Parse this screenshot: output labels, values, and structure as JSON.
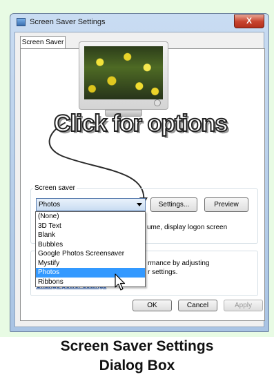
{
  "window": {
    "title": "Screen Saver Settings",
    "close_glyph": "X",
    "title_icon": "screen-saver-icon"
  },
  "tab": {
    "label": "Screen Saver"
  },
  "callout": {
    "text": "Click for options"
  },
  "screensaver": {
    "group_label": "Screen saver",
    "selected": "Photos",
    "settings_label": "Settings...",
    "preview_label": "Preview",
    "resume_text_fragment": "ume, display logon screen",
    "options": [
      "(None)",
      "3D Text",
      "Blank",
      "Bubbles",
      "Google Photos Screensaver",
      "Mystify",
      "Photos",
      "Ribbons"
    ],
    "highlighted_index": 6
  },
  "power": {
    "text_line1": "rmance by adjusting",
    "text_line2": "r settings.",
    "link": "Change power settings"
  },
  "buttons": {
    "ok": "OK",
    "cancel": "Cancel",
    "apply": "Apply"
  },
  "caption": {
    "line1": "Screen Saver Settings",
    "line2": "Dialog Box"
  },
  "colors": {
    "selection": "#3399ff",
    "close": "#c8442f",
    "link": "#0645ad",
    "page_background": "#e8fbe4"
  }
}
